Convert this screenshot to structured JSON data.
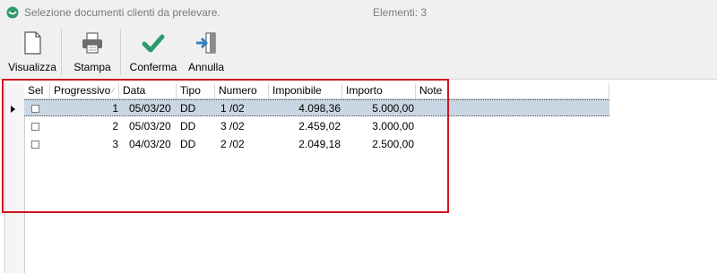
{
  "window": {
    "title": "Selezione documenti clienti da prelevare.",
    "count_label": "Elementi: 3"
  },
  "toolbar": {
    "visualizza": "Visualizza",
    "stampa": "Stampa",
    "conferma": "Conferma",
    "annulla": "Annulla"
  },
  "icons": {
    "app": "app-logo-icon",
    "visualizza": "document-icon",
    "stampa": "printer-icon",
    "conferma": "checkmark-icon",
    "annulla": "exit-door-icon"
  },
  "colors": {
    "app_icon": "#2e9a6a",
    "conferma": "#2e9a6a",
    "annulla": "#3a7fc1",
    "selected_row": "#c9d6e3",
    "highlight_box": "#d0151e"
  },
  "table": {
    "columns": [
      "Sel",
      "Progressivo",
      "Data",
      "Tipo",
      "Numero",
      "Imponibile",
      "Importo",
      "Note"
    ],
    "rows": [
      {
        "sel": false,
        "progressivo": "1",
        "data": "05/03/20",
        "tipo": "DD",
        "numero": "1 /02",
        "imponibile": "4.098,36",
        "importo": "5.000,00",
        "note": "",
        "selected": true
      },
      {
        "sel": false,
        "progressivo": "2",
        "data": "05/03/20",
        "tipo": "DD",
        "numero": "3 /02",
        "imponibile": "2.459,02",
        "importo": "3.000,00",
        "note": "",
        "selected": false
      },
      {
        "sel": false,
        "progressivo": "3",
        "data": "04/03/20",
        "tipo": "DD",
        "numero": "2 /02",
        "imponibile": "2.049,18",
        "importo": "2.500,00",
        "note": "",
        "selected": false
      }
    ]
  }
}
